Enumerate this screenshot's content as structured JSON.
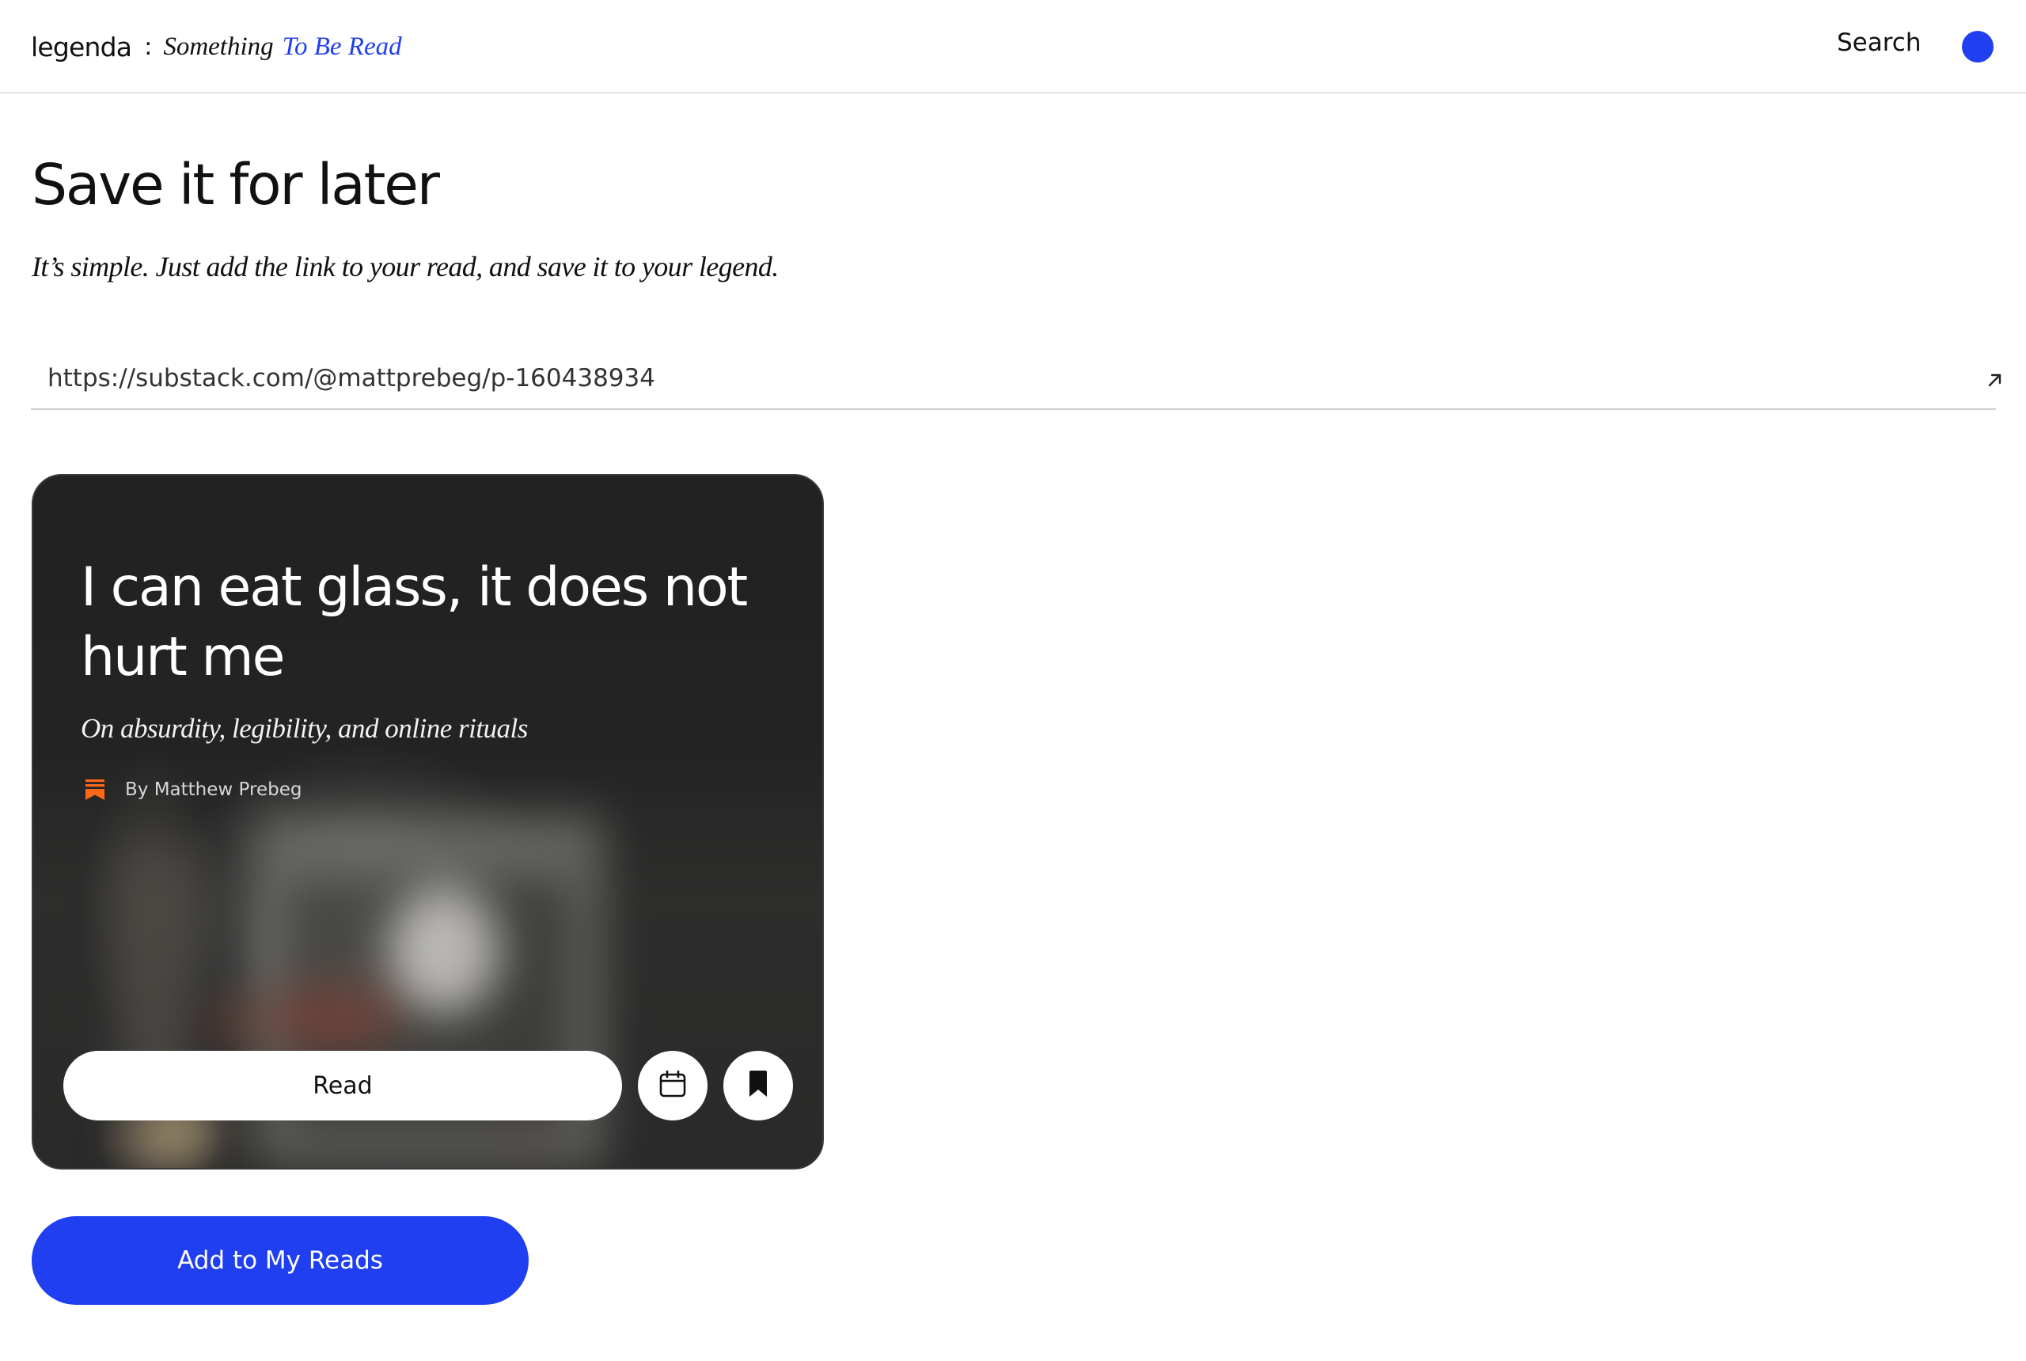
{
  "header": {
    "brand_name": "legenda",
    "separator": ":",
    "tagline_part1": "Something",
    "tagline_part2": "To Be Read",
    "search_label": "Search",
    "accent_color": "#1f3ff0"
  },
  "main": {
    "title": "Save it for later",
    "subtitle": "It’s simple. Just add the link to your read, and save it to your legend.",
    "url_input": {
      "value": "https://substack.com/@mattprebeg/p-160438934",
      "submit_icon": "arrow-up-right-icon"
    }
  },
  "card": {
    "title": "I can eat glass, it does not hurt me",
    "subtitle": "On absurdity, legibility, and online rituals",
    "source_icon": "substack-icon",
    "source_color": "#ff6719",
    "author": "By Matthew Prebeg",
    "read_label": "Read",
    "calendar_icon": "calendar-icon",
    "bookmark_icon": "bookmark-icon",
    "background_color": "#232323"
  },
  "actions": {
    "add_label": "Add to My Reads"
  }
}
